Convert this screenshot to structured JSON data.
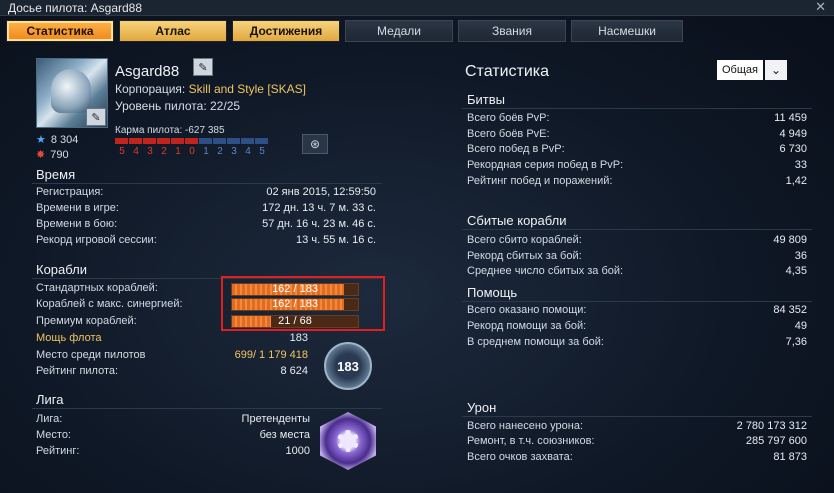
{
  "window": {
    "title": "Досье пилота: Asgard88",
    "close": "✕"
  },
  "tabs": [
    "Статистика",
    "Атлас",
    "Достижения",
    "Медали",
    "Звания",
    "Насмешки"
  ],
  "profile": {
    "name": "Asgard88",
    "corp_label": "Корпорация: ",
    "corp_value": "Skill and Style [SKAS]",
    "level": "Уровень пилота: 22/25",
    "stars": "8 304",
    "shield": "790",
    "karma_label": "Карма пилота: -627 385",
    "karma_nums": [
      "5",
      "4",
      "3",
      "2",
      "1",
      "0",
      "1",
      "2",
      "3",
      "4",
      "5"
    ]
  },
  "time": {
    "title": "Время",
    "rows": [
      {
        "k": "Регистрация:",
        "v": "02 янв 2015, 12:59:50"
      },
      {
        "k": "Времени в игре:",
        "v": "172 дн. 13 ч. 7 м. 33 с."
      },
      {
        "k": "Времени в бою:",
        "v": "57 дн. 16 ч. 23 м. 46 с."
      },
      {
        "k": "Рекорд игровой сессии:",
        "v": "13 ч. 55 м. 16 с."
      }
    ]
  },
  "ships": {
    "title": "Корабли",
    "bars": [
      {
        "k": "Стандартных кораблей:",
        "v": "162 / 183",
        "frac": 0.885
      },
      {
        "k": "Кораблей с макс. синергией:",
        "v": "162 / 183",
        "frac": 0.885
      },
      {
        "k": "Премиум кораблей:",
        "v": "21 / 68",
        "frac": 0.309
      }
    ],
    "fleet_k": "Мощь флота",
    "fleet_v": "183",
    "place_k": "Место среди пилотов",
    "place_v1": "699",
    "place_v2": "/ 1 179 418",
    "rating_k": "Рейтинг пилота:",
    "rating_v": "8 624",
    "badge": "183"
  },
  "league": {
    "title": "Лига",
    "rows": [
      {
        "k": "Лига:",
        "v": "Претенденты"
      },
      {
        "k": "Место:",
        "v": "без места"
      },
      {
        "k": "Рейтинг:",
        "v": "1000"
      }
    ]
  },
  "stats": {
    "title": "Статистика",
    "dropdown": "Общая",
    "battles": {
      "title": "Битвы",
      "rows": [
        {
          "k": "Всего боёв PvP:",
          "v": "11 459"
        },
        {
          "k": "Всего боёв PvE:",
          "v": "4 949"
        },
        {
          "k": "Всего побед в PvP:",
          "v": "6 730"
        },
        {
          "k": "Рекордная серия побед в PvP:",
          "v": "33"
        },
        {
          "k": "Рейтинг побед и поражений:",
          "v": "1,42"
        }
      ]
    },
    "kills": {
      "title": "Сбитые корабли",
      "rows": [
        {
          "k": "Всего сбито кораблей:",
          "v": "49 809"
        },
        {
          "k": "Рекорд сбитых за бой:",
          "v": "36"
        },
        {
          "k": "Среднее число сбитых за бой:",
          "v": "4,35"
        }
      ]
    },
    "assist": {
      "title": "Помощь",
      "rows": [
        {
          "k": "Всего оказано помощи:",
          "v": "84 352"
        },
        {
          "k": "Рекорд помощи за бой:",
          "v": "49"
        },
        {
          "k": "В среднем помощи за бой:",
          "v": "7,36"
        }
      ]
    },
    "damage": {
      "title": "Урон",
      "rows": [
        {
          "k": "Всего нанесено урона:",
          "v": "2 780 173 312"
        },
        {
          "k": "Ремонт, в т.ч. союзников:",
          "v": "285 797 600"
        },
        {
          "k": "Всего очков захвата:",
          "v": "81 873"
        }
      ]
    }
  }
}
